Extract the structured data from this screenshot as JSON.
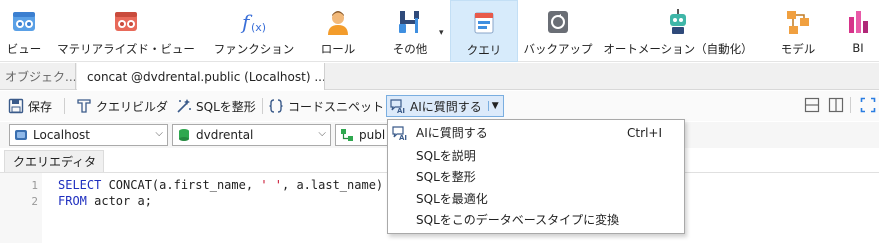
{
  "ribbon": {
    "items": [
      {
        "label": "ビュー",
        "icon": "view-icon"
      },
      {
        "label": "マテリアライズド・ビュー",
        "icon": "materialized-view-icon"
      },
      {
        "label": "ファンクション",
        "icon": "function-icon"
      },
      {
        "label": "ロール",
        "icon": "role-icon"
      },
      {
        "label": "その他",
        "icon": "tools-icon"
      },
      {
        "label": "クエリ",
        "icon": "query-icon"
      },
      {
        "label": "バックアップ",
        "icon": "backup-icon"
      },
      {
        "label": "オートメーション（自動化）",
        "icon": "automation-icon"
      },
      {
        "label": "モデル",
        "icon": "model-icon"
      },
      {
        "label": "BI",
        "icon": "bi-icon"
      }
    ]
  },
  "tabs": {
    "objects": "オブジェク...",
    "query_tab": "concat @dvdrental.public (Localhost) ..."
  },
  "toolbar": {
    "save": "保存",
    "query_builder": "クエリビルダ",
    "format_sql": "SQLを整形",
    "code_snippet": "コードスニペット",
    "ask_ai": "AIに質問する"
  },
  "selectors": {
    "connection": "Localhost",
    "database": "dvdrental",
    "schema": "publ"
  },
  "editor": {
    "tab_label": "クエリエディタ",
    "lines": [
      {
        "number": "1"
      },
      {
        "number": "2"
      }
    ],
    "line1": {
      "kw": "SELECT",
      "a": " CONCAT(a.first_name, ",
      "str": "' '",
      "b": ", a.last_name)"
    },
    "line2": {
      "kw": "FROM",
      "a": " actor a;"
    }
  },
  "menu": {
    "items": [
      {
        "label": "AIに質問する",
        "shortcut": "Ctrl+I"
      },
      {
        "label": "SQLを説明"
      },
      {
        "label": "SQLを整形"
      },
      {
        "label": "SQLを最適化"
      },
      {
        "label": "SQLをこのデータベースタイプに変換"
      }
    ]
  },
  "colors": {
    "active_ribbon": "#d7ebfb",
    "ai_button": "#dceafa",
    "keyword": "#1f2fbf",
    "string": "#c8102e"
  }
}
